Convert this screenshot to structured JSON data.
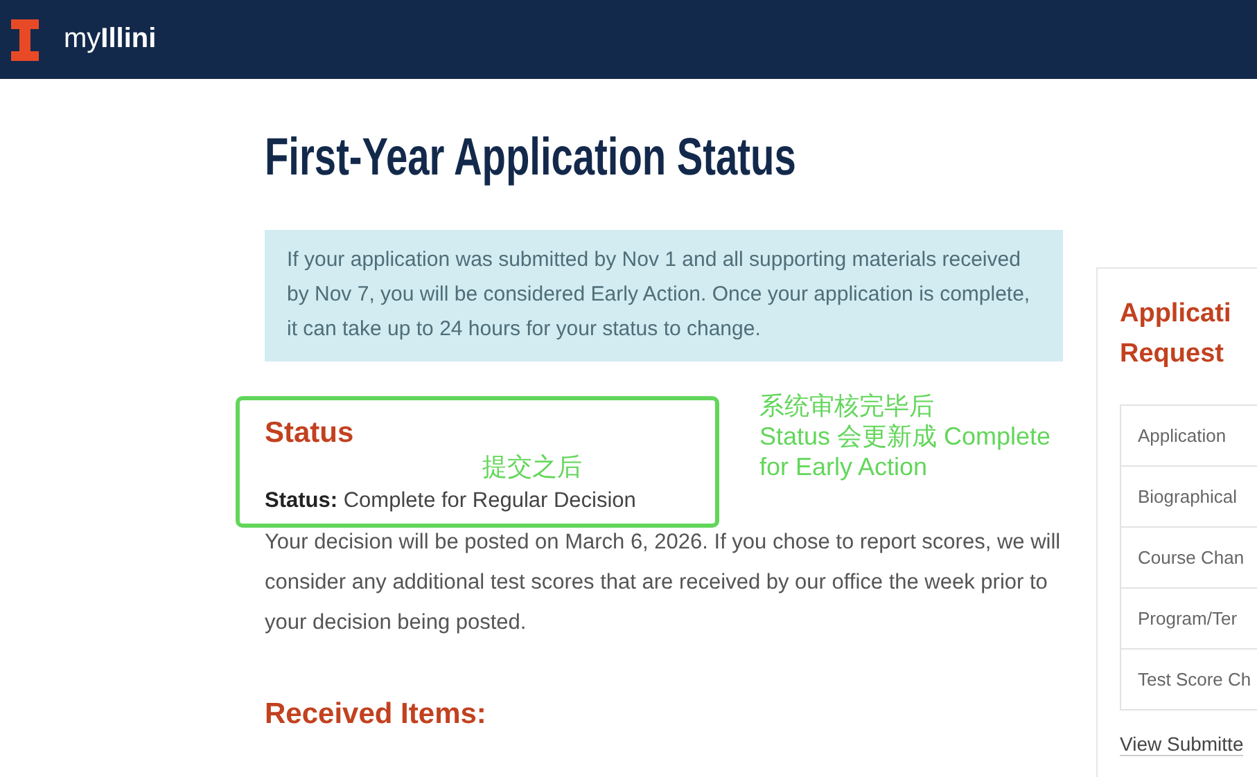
{
  "header": {
    "brand": "my**Illini**"
  },
  "page": {
    "title": "First-Year Application Status",
    "notice": "If your application was submitted by Nov 1 and all supporting materials received by Nov 7, you will be considered Early Action. Once your application is complete, it can take up to 24 hours for your status to change.",
    "status_heading": "Status",
    "status_label": "Status:",
    "status_value": "Complete for Regular Decision",
    "status_note": "Your decision will be posted on March 6, 2026. If you chose to report scores, we will consider any additional test scores that are received by our office the week prior to your decision being posted.",
    "received_heading": "Received Items:"
  },
  "sidebar": {
    "title_lines": [
      "Applicati",
      "Request"
    ],
    "items": [
      "Application",
      "Biographical",
      "Course Chan",
      "Program/Ter",
      "Test Score Ch"
    ],
    "link": "View Submitte"
  },
  "annotations": {
    "left_note": "提交之后",
    "right_note_lines": [
      "系统审核完毕后",
      "Status 会更新成 Complete",
      "for Early Action"
    ]
  }
}
